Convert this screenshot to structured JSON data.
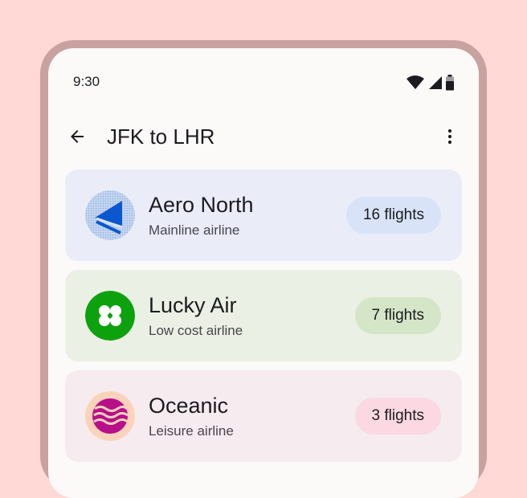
{
  "status_bar": {
    "time": "9:30",
    "icons": [
      "wifi-icon",
      "signal-icon",
      "battery-icon"
    ]
  },
  "top_bar": {
    "title": "JFK to LHR",
    "back_icon": "arrow-back-icon",
    "more_icon": "more-vert-icon"
  },
  "airlines": [
    {
      "name": "Aero North",
      "subtitle": "Mainline airline",
      "flights": "16 flights",
      "logo": "aero-north-logo",
      "card_color": "#eaedf8",
      "chip_color": "#d8e3f8"
    },
    {
      "name": "Lucky Air",
      "subtitle": "Low cost airline",
      "flights": "7 flights",
      "logo": "lucky-air-logo",
      "card_color": "#eaf0e3",
      "chip_color": "#d5e5c8"
    },
    {
      "name": "Oceanic",
      "subtitle": "Leisure airline",
      "flights": "3 flights",
      "logo": "oceanic-logo",
      "card_color": "#f6ebef",
      "chip_color": "#fbd8e2"
    }
  ]
}
